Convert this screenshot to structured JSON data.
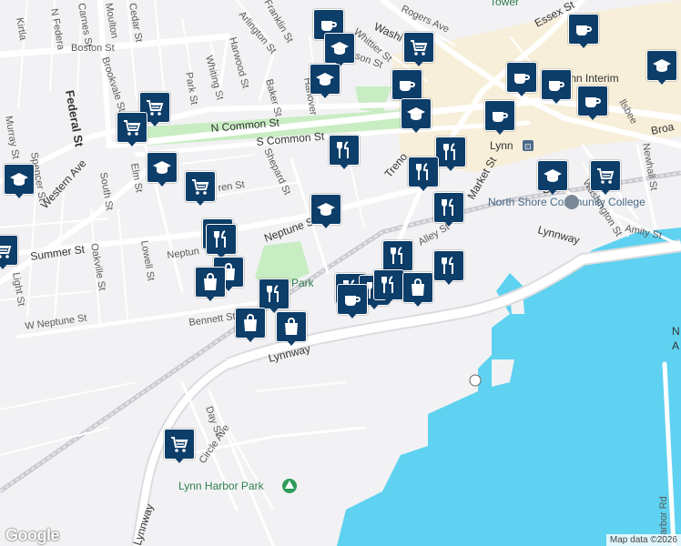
{
  "map": {
    "attribution": "Map data ©2026",
    "logo": "Google",
    "streets": [
      {
        "id": "boston-st",
        "text": "Boston St"
      },
      {
        "id": "federal-st",
        "text": "Federal St"
      },
      {
        "id": "western-ave",
        "text": "Western Ave"
      },
      {
        "id": "spencer-st",
        "text": "Spencer St"
      },
      {
        "id": "murray-st",
        "text": "Murray St"
      },
      {
        "id": "summer-st",
        "text": "Summer St"
      },
      {
        "id": "light-st",
        "text": "Light St"
      },
      {
        "id": "w-neptune-st",
        "text": "W Neptune St"
      },
      {
        "id": "oakville-st",
        "text": "Oakville St"
      },
      {
        "id": "lowell-st",
        "text": "Lowell St"
      },
      {
        "id": "south-st",
        "text": "South St"
      },
      {
        "id": "elm-st",
        "text": "Elm St"
      },
      {
        "id": "brookvale-st",
        "text": "Brookvale St"
      },
      {
        "id": "park-st",
        "text": "Park St"
      },
      {
        "id": "whiting-st",
        "text": "Whiting St"
      },
      {
        "id": "harwood-st",
        "text": "Harwood St"
      },
      {
        "id": "arlington-st",
        "text": "Arlington St"
      },
      {
        "id": "baker-st",
        "text": "Baker St"
      },
      {
        "id": "n-common-st",
        "text": "N Common St"
      },
      {
        "id": "s-common-st",
        "text": "S Common St"
      },
      {
        "id": "shepard-st",
        "text": "Shepard St"
      },
      {
        "id": "warren-st",
        "text": "ren St"
      },
      {
        "id": "neptune-st",
        "text": "Neptune St"
      },
      {
        "id": "neptune-st-2",
        "text": "Neptun"
      },
      {
        "id": "bennett-st",
        "text": "Bennett St"
      },
      {
        "id": "lynnway",
        "text": "Lynnway"
      },
      {
        "id": "lynnway-2",
        "text": "Lynnway"
      },
      {
        "id": "lynnway-3",
        "text": "Lynnway"
      },
      {
        "id": "day-st",
        "text": "Day St"
      },
      {
        "id": "circle-ave",
        "text": "Circle Ave"
      },
      {
        "id": "rogers-ave",
        "text": "Rogers Ave"
      },
      {
        "id": "whittier-st",
        "text": "Whittier St"
      },
      {
        "id": "essex-st",
        "text": "Essex St"
      },
      {
        "id": "market-st",
        "text": "Market St"
      },
      {
        "id": "alley-st",
        "text": "Alley St"
      },
      {
        "id": "washington-st",
        "text": "Washington St"
      },
      {
        "id": "newhall-st",
        "text": "Newhall St"
      },
      {
        "id": "amity-st",
        "text": "Amity St"
      },
      {
        "id": "broad-st",
        "text": "Broa"
      },
      {
        "id": "n-federal",
        "text": "N Federa"
      },
      {
        "id": "cedar-st",
        "text": "Cedar St"
      },
      {
        "id": "moulton",
        "text": "Moulton"
      },
      {
        "id": "carnes-st",
        "text": "Carnes St"
      },
      {
        "id": "kirtland",
        "text": "Kirtla"
      },
      {
        "id": "harbor-rd",
        "text": "Harbor Rd"
      },
      {
        "id": "hanover",
        "text": "Hanover"
      },
      {
        "id": "franklin-st",
        "text": "Franklin St"
      },
      {
        "id": "johnson-st",
        "text": "hnson St"
      },
      {
        "id": "trenton",
        "text": "Treno"
      },
      {
        "id": "washing",
        "text": "Washi"
      },
      {
        "id": "b-ave",
        "text": "B"
      },
      {
        "id": "ellsbee",
        "text": "llsbee"
      }
    ],
    "places": [
      {
        "id": "lynn-station",
        "text": "Lynn"
      },
      {
        "id": "north-shore-cc",
        "text": "North Shore Community College"
      },
      {
        "id": "lynn-harbor-park",
        "text": "Lynn Harbor Park"
      },
      {
        "id": "mcmahon-park",
        "text": "Park"
      },
      {
        "id": "lynn-interim",
        "text": "Lynn Interim"
      },
      {
        "id": "tower",
        "text": "Tower"
      },
      {
        "id": "letter-n",
        "text": "N"
      },
      {
        "id": "letter-a",
        "text": "A"
      }
    ],
    "markers": [
      {
        "id": "m1",
        "icon": "coffee"
      },
      {
        "id": "m2",
        "icon": "school"
      },
      {
        "id": "m3",
        "icon": "cart"
      },
      {
        "id": "m4",
        "icon": "coffee"
      },
      {
        "id": "m5",
        "icon": "school"
      },
      {
        "id": "m6",
        "icon": "coffee"
      },
      {
        "id": "m7",
        "icon": "coffee"
      },
      {
        "id": "m8",
        "icon": "coffee"
      },
      {
        "id": "m9",
        "icon": "coffee"
      },
      {
        "id": "m10",
        "icon": "school"
      },
      {
        "id": "m11",
        "icon": "school"
      },
      {
        "id": "m12",
        "icon": "coffee"
      },
      {
        "id": "m13",
        "icon": "cart"
      },
      {
        "id": "m14",
        "icon": "cart"
      },
      {
        "id": "m15",
        "icon": "school"
      },
      {
        "id": "m16",
        "icon": "school"
      },
      {
        "id": "m17",
        "icon": "cart"
      },
      {
        "id": "m18",
        "icon": "restaurant"
      },
      {
        "id": "m19",
        "icon": "restaurant"
      },
      {
        "id": "m20",
        "icon": "restaurant"
      },
      {
        "id": "m21",
        "icon": "school"
      },
      {
        "id": "m22",
        "icon": "cart"
      },
      {
        "id": "m23",
        "icon": "school"
      },
      {
        "id": "m24",
        "icon": "restaurant"
      },
      {
        "id": "m25",
        "icon": "cart"
      },
      {
        "id": "m26",
        "icon": "restaurant"
      },
      {
        "id": "m27",
        "icon": "bag"
      },
      {
        "id": "m28",
        "icon": "bag"
      },
      {
        "id": "m29",
        "icon": "restaurant"
      },
      {
        "id": "m30",
        "icon": "restaurant"
      },
      {
        "id": "m31",
        "icon": "restaurant"
      },
      {
        "id": "m32",
        "icon": "restaurant"
      },
      {
        "id": "m33",
        "icon": "restaurant"
      },
      {
        "id": "m34",
        "icon": "restaurant"
      },
      {
        "id": "m35",
        "icon": "bag"
      },
      {
        "id": "m36",
        "icon": "coffee"
      },
      {
        "id": "m37",
        "icon": "bag"
      },
      {
        "id": "m38",
        "icon": "bag"
      },
      {
        "id": "m39",
        "icon": "cart"
      },
      {
        "id": "m40",
        "icon": "cart"
      }
    ],
    "colors": {
      "land": "#f2f2f4",
      "water": "#5ed2f0",
      "park": "#c8edc2",
      "marker": "#0d3d69",
      "road": "#ffffff",
      "highway": "#dadce0",
      "downtown": "#f7efd9"
    }
  }
}
